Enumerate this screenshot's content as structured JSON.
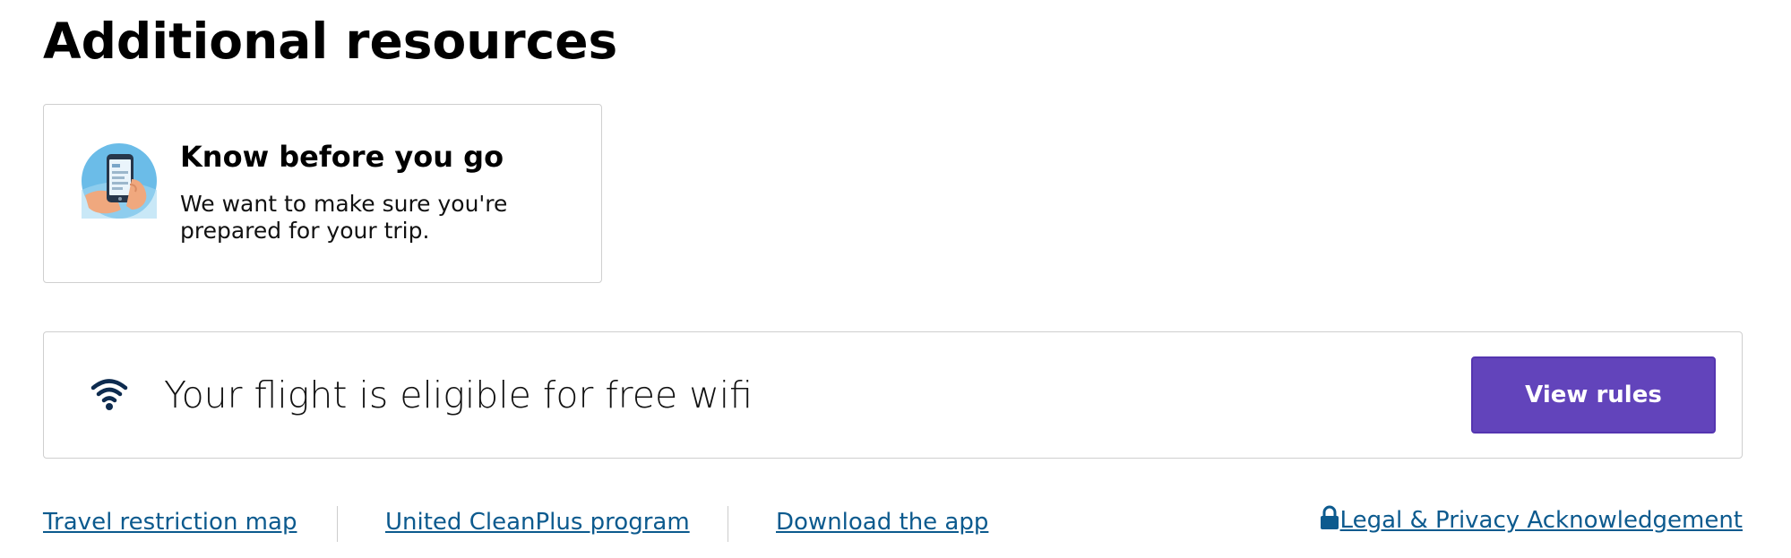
{
  "heading": "Additional resources",
  "info_card": {
    "title": "Know before you go",
    "description": "We want to make sure you're prepared for your trip.",
    "icon": "phone-in-hand-illustration"
  },
  "wifi_banner": {
    "icon": "wifi-icon",
    "text": "Your flight is eligible for free wifi",
    "button_label": "View rules"
  },
  "footer": {
    "links": [
      {
        "label": "Travel restriction map"
      },
      {
        "label": "United CleanPlus program"
      },
      {
        "label": "Download the app"
      }
    ],
    "legal": {
      "icon": "lock-icon",
      "label": "Legal & Privacy Acknowledgement"
    }
  },
  "colors": {
    "primary_button": "#6244bb",
    "link": "#0c5a8e",
    "border": "#cfcfcf",
    "wifi_icon": "#0d2b4f"
  }
}
